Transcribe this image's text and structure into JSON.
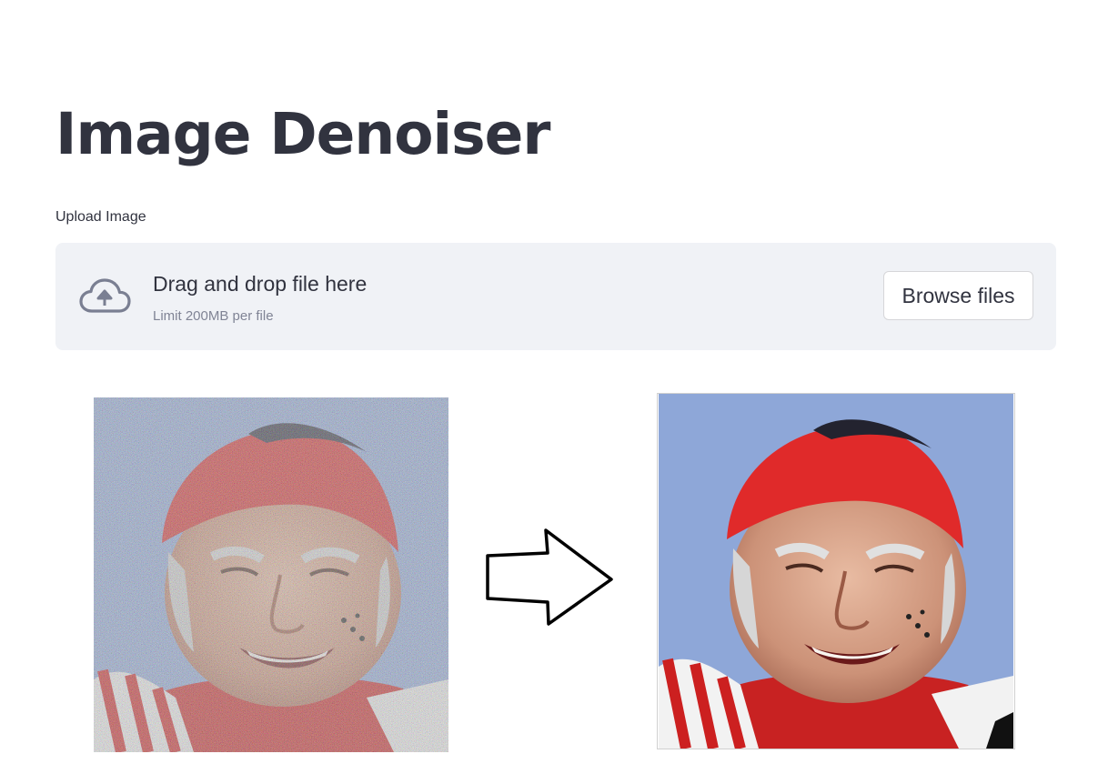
{
  "page": {
    "title": "Image Denoiser"
  },
  "uploader": {
    "label": "Upload Image",
    "drop_text": "Drag and drop file here",
    "limit_text": "Limit 200MB per file",
    "browse_label": "Browse files",
    "icon": "cloud-upload-icon"
  },
  "images": {
    "input_image": "noisy-input-image",
    "output_image": "denoised-output-image",
    "arrow_icon": "right-arrow-icon"
  },
  "colors": {
    "text": "#31333f",
    "muted": "#808495",
    "dropzone_bg": "#f0f2f6",
    "sky": "#8ea7d8",
    "cap_red": "#d42a2a"
  }
}
